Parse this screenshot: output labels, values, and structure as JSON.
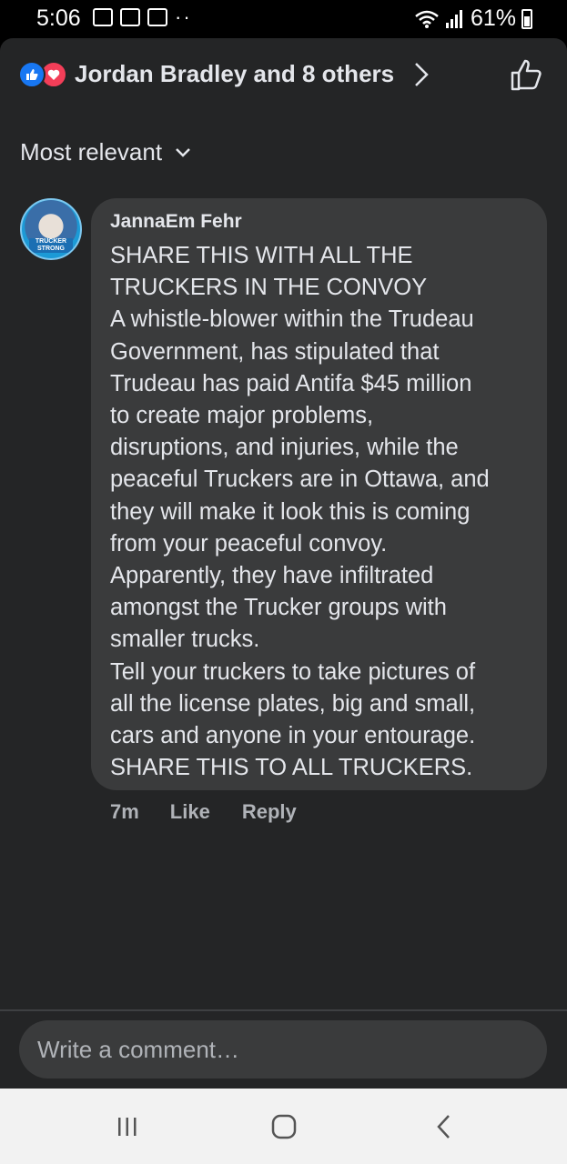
{
  "status_bar": {
    "time": "5:06",
    "dots": "··",
    "battery_percent": "61%"
  },
  "header": {
    "reactors_text": "Jordan Bradley and 8 others",
    "reactions": [
      "like-icon",
      "love-icon"
    ]
  },
  "sort": {
    "label": "Most relevant"
  },
  "comment": {
    "avatar_text": "TRUCKER STRONG",
    "author": "JannaEm Fehr",
    "lines": [
      "SHARE THIS WITH ALL THE",
      "TRUCKERS IN THE CONVOY",
      "A whistle-blower within the Trudeau",
      "Government, has stipulated that",
      "Trudeau has paid Antifa $45 million",
      "to create major problems,",
      "disruptions, and injuries, while the",
      "peaceful Truckers are in Ottawa, and",
      "they will make it look this is coming",
      "from your peaceful convoy.",
      "Apparently, they have infiltrated",
      "amongst the Trucker groups with",
      "smaller trucks.",
      "Tell your truckers to take pictures of",
      "all the license plates, big and small,",
      "cars and anyone in your entourage.",
      "SHARE THIS TO ALL TRUCKERS."
    ],
    "time": "7m",
    "like_label": "Like",
    "reply_label": "Reply"
  },
  "composer": {
    "placeholder": "Write a comment…"
  },
  "colors": {
    "panel": "#242526",
    "bubble": "#3a3b3c",
    "like_blue": "#1877f2",
    "love_red": "#f33e58"
  }
}
